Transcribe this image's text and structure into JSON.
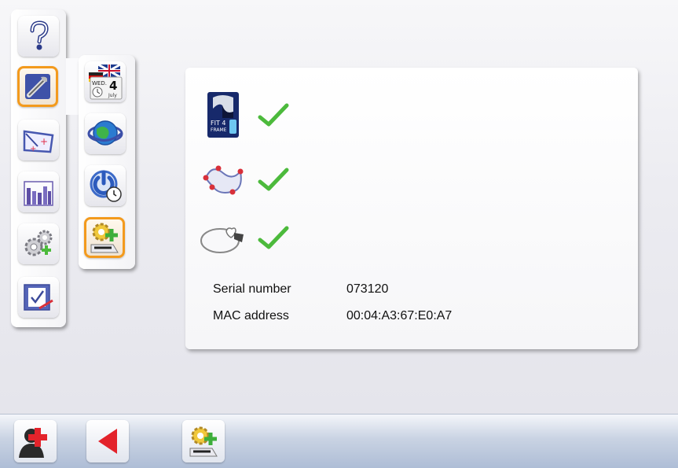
{
  "main_menu": {
    "items": [
      {
        "name": "help",
        "icon": "question-icon"
      },
      {
        "name": "tools",
        "icon": "wrench-icon",
        "selected": true
      },
      {
        "name": "shape-edit",
        "icon": "shape-edit-icon"
      },
      {
        "name": "statistics",
        "icon": "bar-chart-icon"
      },
      {
        "name": "settings",
        "icon": "gears-icon"
      },
      {
        "name": "checklist",
        "icon": "checklist-icon"
      }
    ]
  },
  "sub_menu": {
    "items": [
      {
        "name": "date-language",
        "icon": "calendar-flag-icon",
        "calendar_day_label": "WED.",
        "calendar_day": "4",
        "calendar_month": "July"
      },
      {
        "name": "network",
        "icon": "globe-icon"
      },
      {
        "name": "standby",
        "icon": "power-clock-icon"
      },
      {
        "name": "options",
        "icon": "gear-plus-icon",
        "selected": true
      }
    ]
  },
  "panel": {
    "features": [
      {
        "icon": "fit4frame-icon",
        "logo_text_1": "FIT 4",
        "logo_text_2": "FRAME",
        "status": "enabled"
      },
      {
        "icon": "shape-curve-icon",
        "status": "enabled"
      },
      {
        "icon": "lens-tag-icon",
        "status": "enabled"
      }
    ],
    "serial_label": "Serial number",
    "serial_value": "073120",
    "mac_label": "MAC address",
    "mac_value": "00:04:A3:67:E0:A7"
  },
  "bottom_bar": {
    "buttons": [
      {
        "name": "support",
        "icon": "user-red-cross-icon"
      },
      {
        "name": "back",
        "icon": "red-arrow-left-icon"
      },
      {
        "name": "options",
        "icon": "gear-plus-icon"
      }
    ]
  },
  "colors": {
    "accent_selected": "#f39a1d",
    "check_green": "#4cba3c",
    "back_arrow_red": "#e3232b"
  }
}
